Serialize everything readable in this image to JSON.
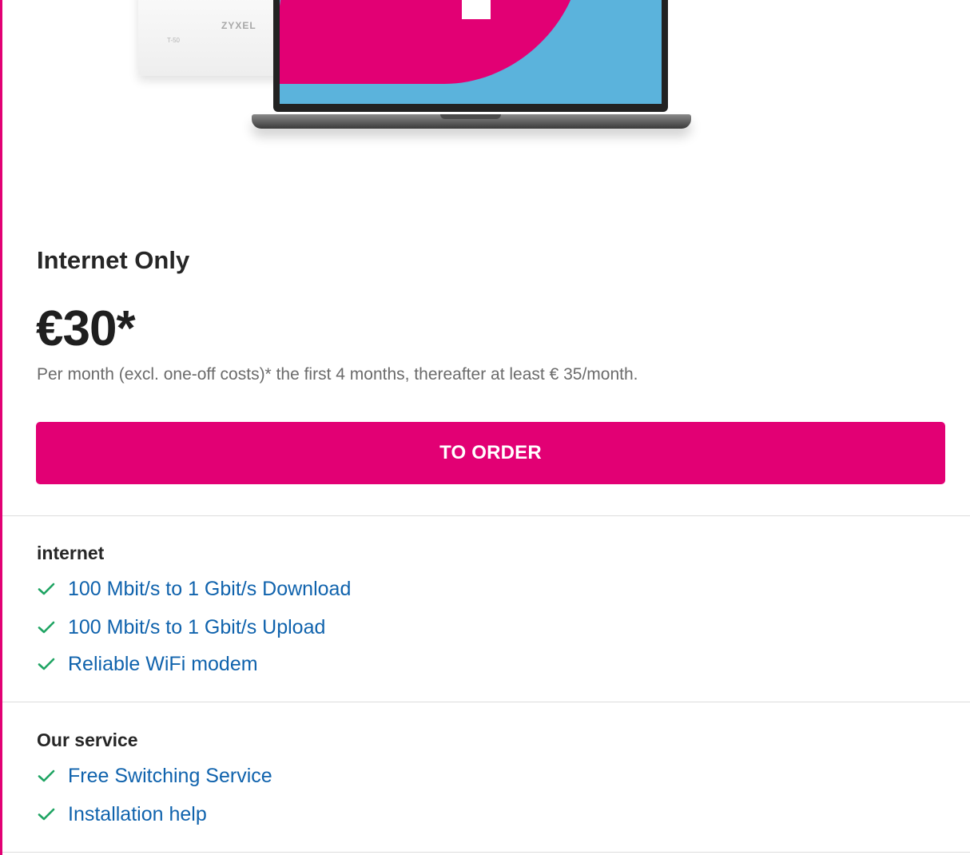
{
  "hero": {
    "router_brand": "ZYXEL",
    "router_model": "T-50"
  },
  "plan": {
    "title": "Internet Only",
    "price": "€30*",
    "price_note": "Per month (excl. one-off costs)* the first 4 months, thereafter at least € 35/month."
  },
  "actions": {
    "order_label": "TO ORDER"
  },
  "sections": {
    "internet": {
      "heading": "internet",
      "features": [
        "100 Mbit/s to 1 Gbit/s Download",
        "100 Mbit/s to 1 Gbit/s Upload",
        "Reliable WiFi modem"
      ]
    },
    "service": {
      "heading": "Our service",
      "features": [
        "Free Switching Service",
        "Installation help"
      ]
    }
  },
  "colors": {
    "brand_magenta": "#e20074",
    "link_blue": "#1063ad",
    "check_green": "#1fa463"
  },
  "icons": {
    "feature_check": "check-icon"
  }
}
